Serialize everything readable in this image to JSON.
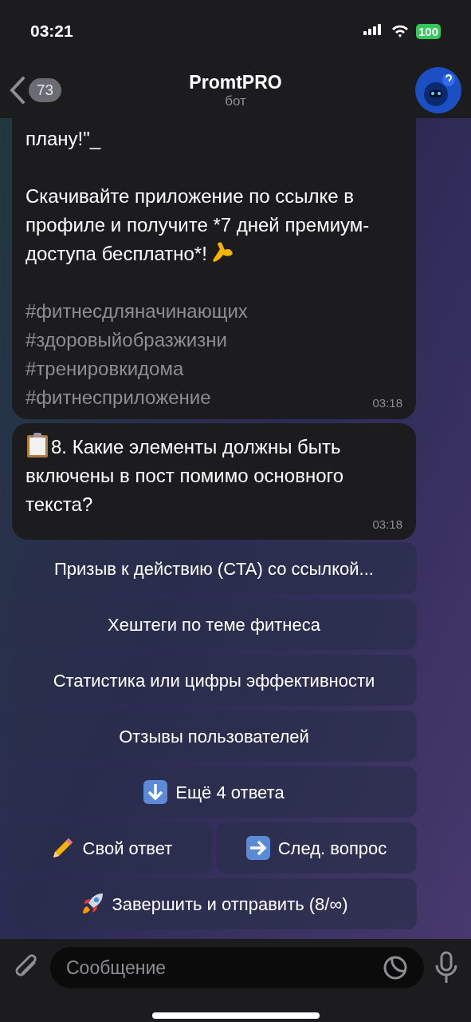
{
  "status_bar": {
    "time": "03:21",
    "battery": "100"
  },
  "header": {
    "back_count": "73",
    "title": "PromtPRO",
    "subtitle": "бот"
  },
  "messages": [
    {
      "kind": "post",
      "paragraphs": [
        "плану!\"_",
        "Скачивайте приложение по ссылке в профиле и получите *7 дней премиум-доступа бесплатно*!"
      ],
      "hashtags": [
        "#фитнесдляначинающих",
        "#здоровыйобразжизни",
        "#тренировкидома",
        "#фитнесприложение"
      ],
      "time": "03:18",
      "cut_top": true
    },
    {
      "kind": "question",
      "paragraphs": [
        "8. Какие элементы должны быть включены в пост помимо основного текста?"
      ],
      "time": "03:18",
      "cut_top": false
    }
  ],
  "keyboard": [
    [
      {
        "label": "Призыв к действию (CTA) со ссылкой..."
      }
    ],
    [
      {
        "label": "Хештеги по теме фитнеса"
      }
    ],
    [
      {
        "label": "Статистика или цифры эффективности"
      }
    ],
    [
      {
        "label": "Отзывы пользователей"
      }
    ],
    [
      {
        "label": "Ещё 4 ответа",
        "kind": "more"
      }
    ],
    [
      {
        "label": "Свой ответ",
        "kind": "custom"
      },
      {
        "label": "След. вопрос",
        "kind": "next"
      }
    ],
    [
      {
        "label": "Завершить и отправить (8/∞)",
        "kind": "finish"
      }
    ]
  ],
  "composer": {
    "placeholder": "Сообщение"
  }
}
